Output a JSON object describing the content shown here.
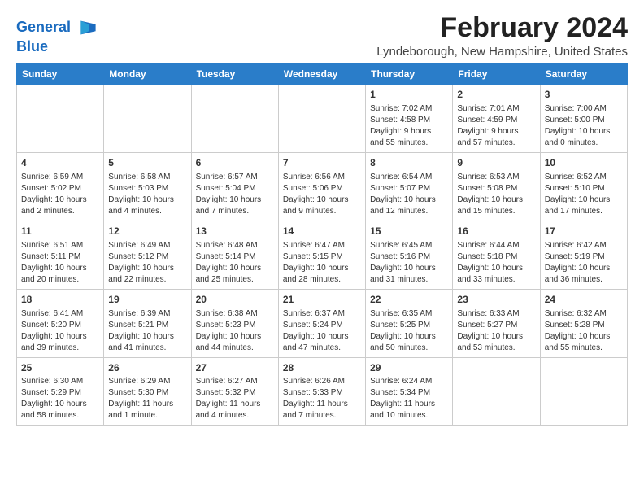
{
  "logo": {
    "line1": "General",
    "line2": "Blue"
  },
  "title": "February 2024",
  "subtitle": "Lyndeborough, New Hampshire, United States",
  "days_of_week": [
    "Sunday",
    "Monday",
    "Tuesday",
    "Wednesday",
    "Thursday",
    "Friday",
    "Saturday"
  ],
  "weeks": [
    [
      {
        "day": "",
        "info": ""
      },
      {
        "day": "",
        "info": ""
      },
      {
        "day": "",
        "info": ""
      },
      {
        "day": "",
        "info": ""
      },
      {
        "day": "1",
        "info": "Sunrise: 7:02 AM\nSunset: 4:58 PM\nDaylight: 9 hours\nand 55 minutes."
      },
      {
        "day": "2",
        "info": "Sunrise: 7:01 AM\nSunset: 4:59 PM\nDaylight: 9 hours\nand 57 minutes."
      },
      {
        "day": "3",
        "info": "Sunrise: 7:00 AM\nSunset: 5:00 PM\nDaylight: 10 hours\nand 0 minutes."
      }
    ],
    [
      {
        "day": "4",
        "info": "Sunrise: 6:59 AM\nSunset: 5:02 PM\nDaylight: 10 hours\nand 2 minutes."
      },
      {
        "day": "5",
        "info": "Sunrise: 6:58 AM\nSunset: 5:03 PM\nDaylight: 10 hours\nand 4 minutes."
      },
      {
        "day": "6",
        "info": "Sunrise: 6:57 AM\nSunset: 5:04 PM\nDaylight: 10 hours\nand 7 minutes."
      },
      {
        "day": "7",
        "info": "Sunrise: 6:56 AM\nSunset: 5:06 PM\nDaylight: 10 hours\nand 9 minutes."
      },
      {
        "day": "8",
        "info": "Sunrise: 6:54 AM\nSunset: 5:07 PM\nDaylight: 10 hours\nand 12 minutes."
      },
      {
        "day": "9",
        "info": "Sunrise: 6:53 AM\nSunset: 5:08 PM\nDaylight: 10 hours\nand 15 minutes."
      },
      {
        "day": "10",
        "info": "Sunrise: 6:52 AM\nSunset: 5:10 PM\nDaylight: 10 hours\nand 17 minutes."
      }
    ],
    [
      {
        "day": "11",
        "info": "Sunrise: 6:51 AM\nSunset: 5:11 PM\nDaylight: 10 hours\nand 20 minutes."
      },
      {
        "day": "12",
        "info": "Sunrise: 6:49 AM\nSunset: 5:12 PM\nDaylight: 10 hours\nand 22 minutes."
      },
      {
        "day": "13",
        "info": "Sunrise: 6:48 AM\nSunset: 5:14 PM\nDaylight: 10 hours\nand 25 minutes."
      },
      {
        "day": "14",
        "info": "Sunrise: 6:47 AM\nSunset: 5:15 PM\nDaylight: 10 hours\nand 28 minutes."
      },
      {
        "day": "15",
        "info": "Sunrise: 6:45 AM\nSunset: 5:16 PM\nDaylight: 10 hours\nand 31 minutes."
      },
      {
        "day": "16",
        "info": "Sunrise: 6:44 AM\nSunset: 5:18 PM\nDaylight: 10 hours\nand 33 minutes."
      },
      {
        "day": "17",
        "info": "Sunrise: 6:42 AM\nSunset: 5:19 PM\nDaylight: 10 hours\nand 36 minutes."
      }
    ],
    [
      {
        "day": "18",
        "info": "Sunrise: 6:41 AM\nSunset: 5:20 PM\nDaylight: 10 hours\nand 39 minutes."
      },
      {
        "day": "19",
        "info": "Sunrise: 6:39 AM\nSunset: 5:21 PM\nDaylight: 10 hours\nand 41 minutes."
      },
      {
        "day": "20",
        "info": "Sunrise: 6:38 AM\nSunset: 5:23 PM\nDaylight: 10 hours\nand 44 minutes."
      },
      {
        "day": "21",
        "info": "Sunrise: 6:37 AM\nSunset: 5:24 PM\nDaylight: 10 hours\nand 47 minutes."
      },
      {
        "day": "22",
        "info": "Sunrise: 6:35 AM\nSunset: 5:25 PM\nDaylight: 10 hours\nand 50 minutes."
      },
      {
        "day": "23",
        "info": "Sunrise: 6:33 AM\nSunset: 5:27 PM\nDaylight: 10 hours\nand 53 minutes."
      },
      {
        "day": "24",
        "info": "Sunrise: 6:32 AM\nSunset: 5:28 PM\nDaylight: 10 hours\nand 55 minutes."
      }
    ],
    [
      {
        "day": "25",
        "info": "Sunrise: 6:30 AM\nSunset: 5:29 PM\nDaylight: 10 hours\nand 58 minutes."
      },
      {
        "day": "26",
        "info": "Sunrise: 6:29 AM\nSunset: 5:30 PM\nDaylight: 11 hours\nand 1 minute."
      },
      {
        "day": "27",
        "info": "Sunrise: 6:27 AM\nSunset: 5:32 PM\nDaylight: 11 hours\nand 4 minutes."
      },
      {
        "day": "28",
        "info": "Sunrise: 6:26 AM\nSunset: 5:33 PM\nDaylight: 11 hours\nand 7 minutes."
      },
      {
        "day": "29",
        "info": "Sunrise: 6:24 AM\nSunset: 5:34 PM\nDaylight: 11 hours\nand 10 minutes."
      },
      {
        "day": "",
        "info": ""
      },
      {
        "day": "",
        "info": ""
      }
    ]
  ]
}
